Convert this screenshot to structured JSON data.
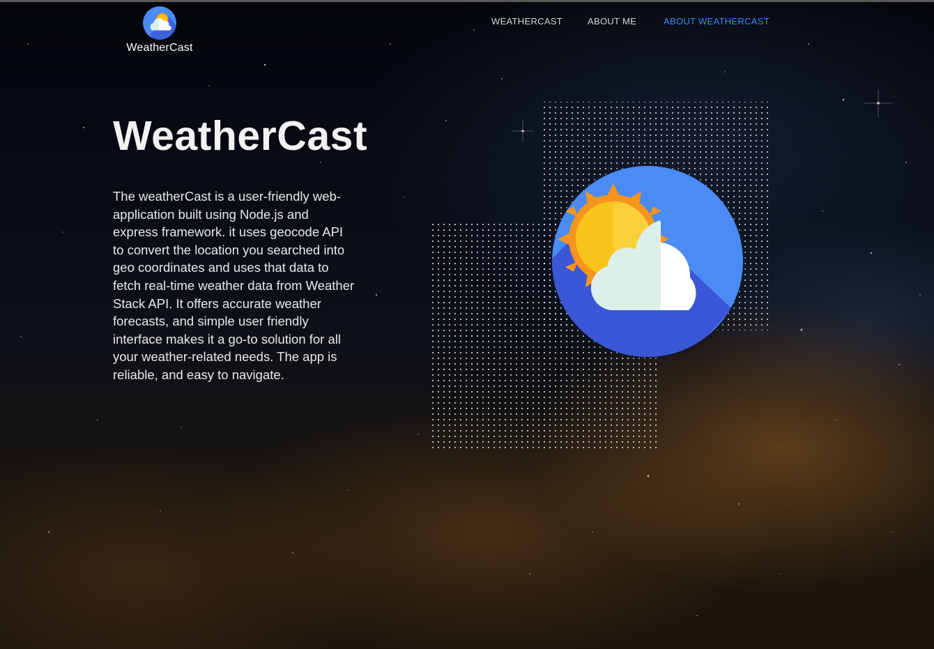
{
  "brand": {
    "name": "WeatherCast",
    "logo_icon": "weather-logo-icon"
  },
  "nav": {
    "items": [
      {
        "label": "WEATHERCAST",
        "active": false
      },
      {
        "label": "ABOUT ME",
        "active": false
      },
      {
        "label": "ABOUT WEATHERCAST",
        "active": true
      }
    ]
  },
  "hero": {
    "title": "WeatherCast",
    "description": "The weatherCast is a user-friendly web-application built using Node.js and express framework. it uses geocode API to convert the location you searched into geo coordinates and uses that data to fetch real-time weather data from Weather Stack API. It offers accurate weather forecasts, and simple user friendly interface makes it a go-to solution for all your weather-related needs. The app is reliable, and easy to navigate.",
    "illustration_icon": "sun-cloud-icon"
  },
  "colors": {
    "accent": "#3d8bff",
    "circle": "#4a8bf4",
    "circle_shadow": "#3b56d6",
    "sun": "#f8c41c",
    "sun_rays": "#f5951e",
    "cloud": "#ffffff",
    "cloud_shade": "#dcefeb"
  }
}
